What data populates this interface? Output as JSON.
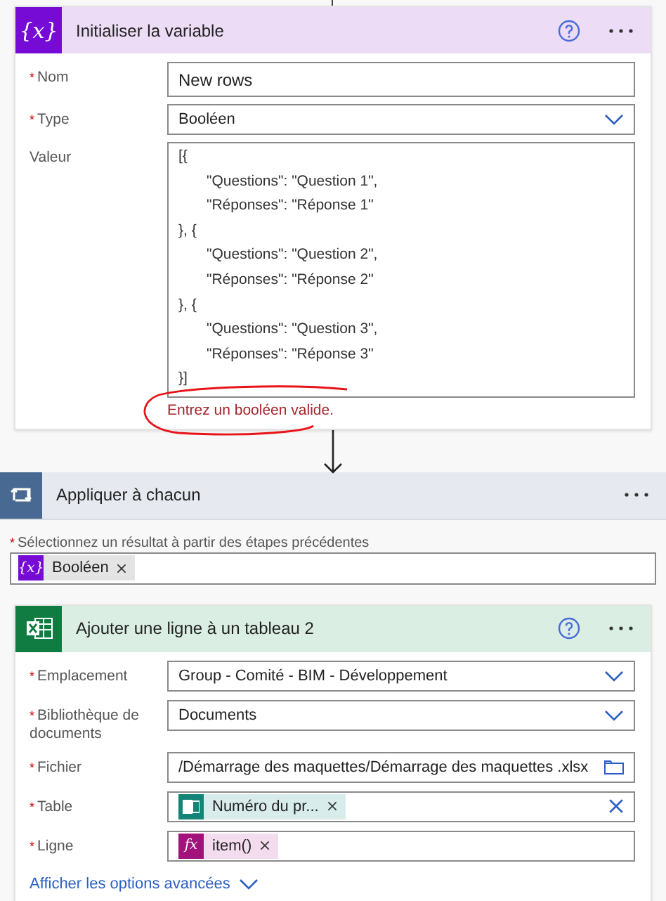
{
  "init_variable": {
    "title": "Initialiser la variable",
    "icon_glyph": "{x}",
    "help": true,
    "fields": [
      {
        "mark": "*",
        "label": "Nom",
        "kind": "text",
        "value": "New rows"
      },
      {
        "mark": "*",
        "label": "Type",
        "kind": "dropdown",
        "value": "Booléen"
      },
      {
        "label": "Valeur",
        "kind": "code",
        "lines": [
          {
            "text": "[{",
            "indented": false
          },
          {
            "text": "\"Questions\": \"Question 1\",",
            "indented": true
          },
          {
            "text": "\"Réponses\": \"Réponse 1\"",
            "indented": true
          },
          {
            "text": "}, {",
            "indented": false
          },
          {
            "text": "\"Questions\": \"Question 2\",",
            "indented": true
          },
          {
            "text": "\"Réponses\": \"Réponse 2\"",
            "indented": true
          },
          {
            "text": "}, {",
            "indented": false
          },
          {
            "text": "\"Questions\": \"Question 3\",",
            "indented": true
          },
          {
            "text": "\"Réponses\": \"Réponse 3\"",
            "indented": true
          },
          {
            "text": "}]",
            "indented": false
          }
        ],
        "error": "Entrez un booléen valide."
      }
    ]
  },
  "apply_each": {
    "title": "Appliquer à chacun",
    "mark": "*",
    "label": "Sélectionnez un résultat à partir des étapes précédentes",
    "tokens": [
      {
        "kind": "variable",
        "glyph": "{x}",
        "text": "Booléen"
      }
    ]
  },
  "add_row": {
    "title": "Ajouter une ligne à un tableau 2",
    "help": true,
    "fields": [
      {
        "mark": "*",
        "label": "Emplacement",
        "kind": "dropdown",
        "value": "Group - Comité - BIM - Développement"
      },
      {
        "mark": "*",
        "label": "Bibliothèque de documents",
        "kind": "dropdown",
        "value": "Documents"
      },
      {
        "mark": "*",
        "label": "Fichier",
        "kind": "file",
        "value": "/Démarrage des maquettes/Démarrage des maquettes .xlsx"
      },
      {
        "mark": "*",
        "label": "Table",
        "kind": "tokens",
        "clearable": true,
        "tokens": [
          {
            "kind": "excel",
            "text": "Numéro du pr..."
          }
        ]
      },
      {
        "mark": "*",
        "label": "Ligne",
        "kind": "tokens",
        "clearable": false,
        "tokens": [
          {
            "kind": "expression",
            "glyph": "fx",
            "text": "item()"
          }
        ]
      }
    ],
    "advanced_link": "Afficher les options avancées"
  }
}
